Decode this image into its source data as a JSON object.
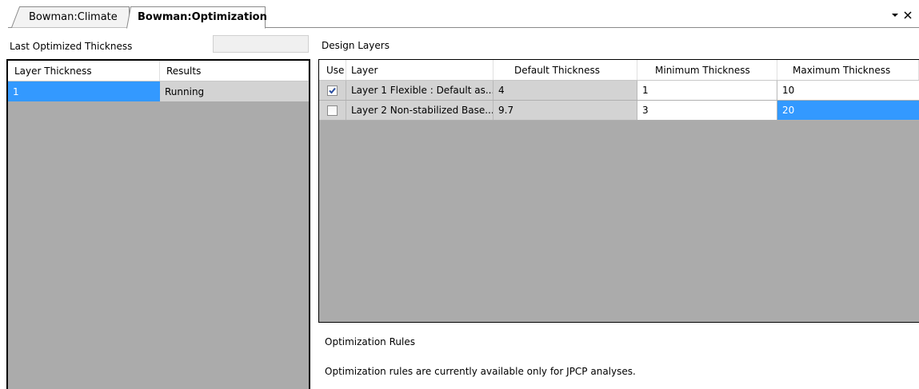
{
  "tabs": [
    {
      "label": "Bowman:Climate",
      "active": false
    },
    {
      "label": "Bowman:Optimization",
      "active": true
    }
  ],
  "window_controls": {
    "dropdown_icon": "chevron-down-icon",
    "close_icon": "close-icon"
  },
  "left_panel": {
    "last_optimized_label": "Last Optimized Thickness",
    "last_optimized_value": "",
    "grid": {
      "columns": [
        "Layer Thickness",
        "Results"
      ],
      "rows": [
        {
          "thickness": "1",
          "result": "Running"
        }
      ]
    }
  },
  "design_layers": {
    "title": "Design Layers",
    "columns": [
      "Use",
      "Layer",
      "Default Thickness",
      "Minimum Thickness",
      "Maximum Thickness"
    ],
    "rows": [
      {
        "use": true,
        "layer": "Layer 1 Flexible : Default as...",
        "default": "4",
        "min": "1",
        "max": "10"
      },
      {
        "use": false,
        "layer": "Layer 2 Non-stabilized Base...",
        "default": "9.7",
        "min": "3",
        "max": "20"
      }
    ]
  },
  "optimization_rules": {
    "title": "Optimization Rules",
    "text": "Optimization rules are currently available only for JPCP analyses."
  },
  "colors": {
    "selection": "#3399ff",
    "grid_background": "#ababab",
    "readonly_cell": "#d3d3d3"
  }
}
